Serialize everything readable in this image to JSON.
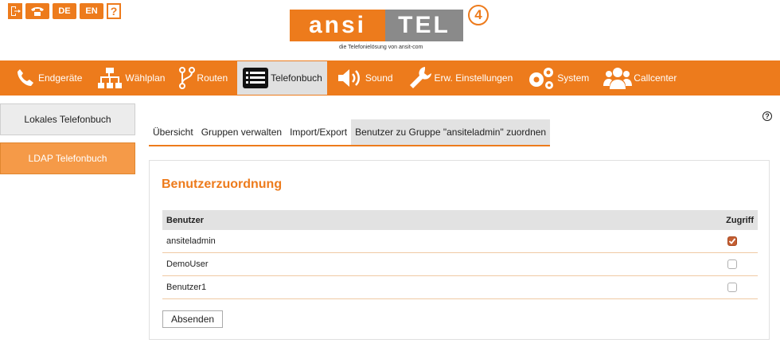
{
  "top_icons": {
    "logout": "logout-icon",
    "phone": "phone-icon",
    "lang_de": "DE",
    "lang_en": "EN",
    "help": "?"
  },
  "logo": {
    "left": "ansi",
    "right": "TEL",
    "version": "4",
    "tagline": "die Telefonielösung von ansit-com"
  },
  "nav": {
    "items": [
      {
        "label": "Endgeräte",
        "icon": "phone-icon"
      },
      {
        "label": "Wählplan",
        "icon": "sitemap-icon"
      },
      {
        "label": "Routen",
        "icon": "route-icon"
      },
      {
        "label": "Telefonbuch",
        "icon": "list-icon",
        "active": true
      },
      {
        "label": "Sound",
        "icon": "speaker-icon"
      },
      {
        "label": "Erw. Einstellungen",
        "icon": "wrench-icon"
      },
      {
        "label": "System",
        "icon": "gears-icon"
      },
      {
        "label": "Callcenter",
        "icon": "users-icon"
      }
    ]
  },
  "sidebar": {
    "local": "Lokales Telefonbuch",
    "ldap": "LDAP Telefonbuch"
  },
  "tabs": [
    {
      "label": "Übersicht"
    },
    {
      "label": "Gruppen verwalten"
    },
    {
      "label": "Import/Export"
    },
    {
      "label": "Benutzer zu Gruppe \"ansiteladmin\" zuordnen",
      "active": true
    }
  ],
  "panel": {
    "title": "Benutzerzuordnung",
    "col_user": "Benutzer",
    "col_access": "Zugriff",
    "rows": [
      {
        "user": "ansiteladmin",
        "access": true
      },
      {
        "user": "DemoUser",
        "access": false
      },
      {
        "user": "Benutzer1",
        "access": false
      }
    ],
    "submit": "Absenden"
  },
  "colors": {
    "accent": "#ed7b1c",
    "ldap_button": "#f59a48",
    "checkbox_checked": "#c45e32"
  }
}
